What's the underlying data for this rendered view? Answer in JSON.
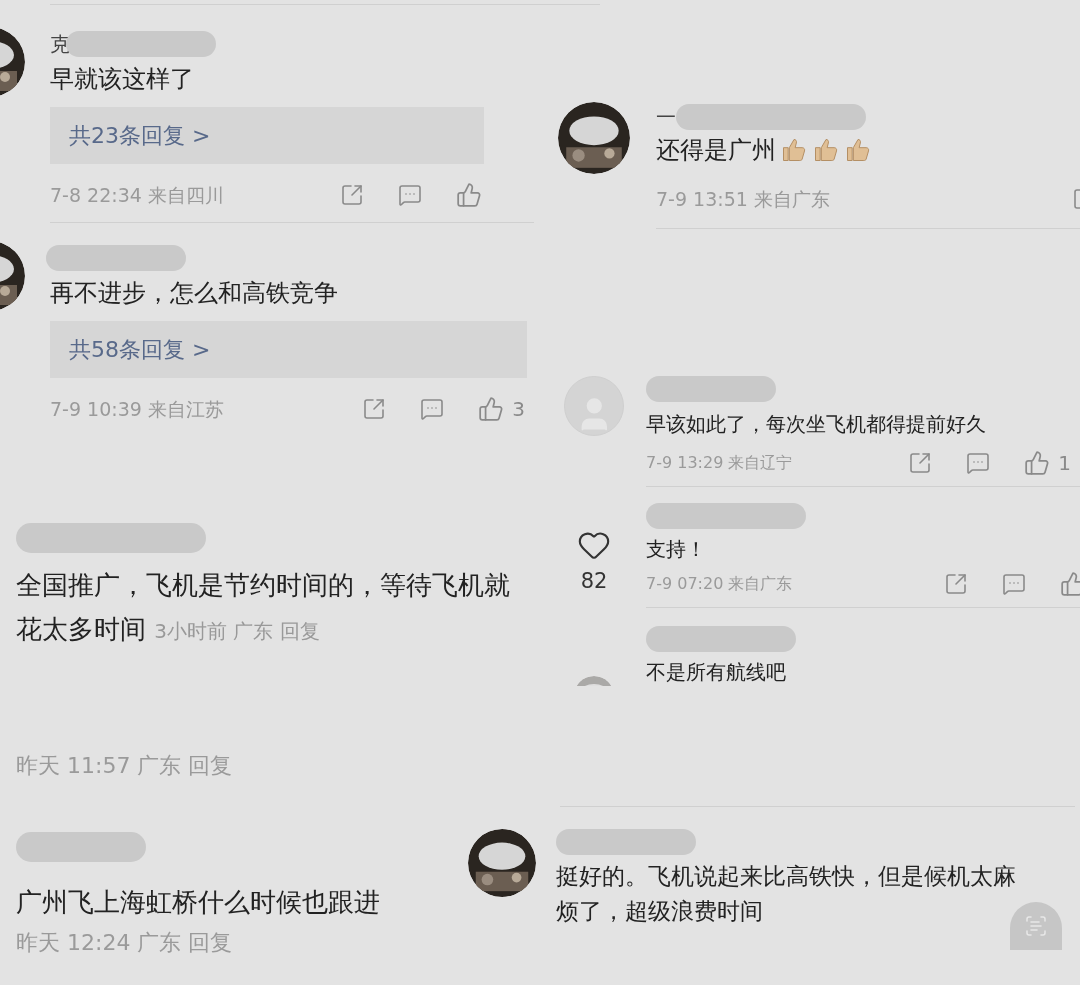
{
  "fragments": [
    {
      "kind": "thread",
      "comments": [
        {
          "name": "克",
          "text": "早就该这样了",
          "replies": "共23条回复 >",
          "time": "7-8 22:34 来自四川"
        },
        {
          "text": "再不进步，怎么和高铁竞争",
          "replies": "共58条回复 >",
          "time": "7-9 10:39 来自江苏",
          "likes": "3"
        }
      ]
    },
    {
      "kind": "thread",
      "comments": [
        {
          "name": "一",
          "text": "还得是广州",
          "thumbs": true,
          "time": "7-9 13:51 来自广东"
        }
      ]
    },
    {
      "kind": "thread",
      "side_likes": "82",
      "comments": [
        {
          "avatar": {
            "kind": "default"
          },
          "text": "早该如此了，每次坐飞机都得提前好久",
          "time": "7-9 13:29 来自辽宁",
          "likes": "1"
        },
        {
          "text": "支持！",
          "time": "7-9 07:20 来自广东"
        },
        {
          "text": "不是所有航线吧"
        }
      ]
    },
    {
      "kind": "plain",
      "comments": [
        {
          "text": "全国推广，飞机是节约时间的，等待飞机就花太多时间",
          "meta": "3小时前 广东 回复"
        },
        {
          "meta": "昨天 11:57 广东 回复"
        }
      ]
    },
    {
      "kind": "plain",
      "comments": [
        {
          "text": "广州飞上海虹桥什么时候也跟进",
          "meta": "昨天 12:24 广东 回复"
        }
      ]
    },
    {
      "kind": "thread",
      "comments": [
        {
          "text": "挺好的。飞机说起来比高铁快，但是候机太麻烦了，超级浪费时间",
          "scan": true
        }
      ]
    }
  ]
}
